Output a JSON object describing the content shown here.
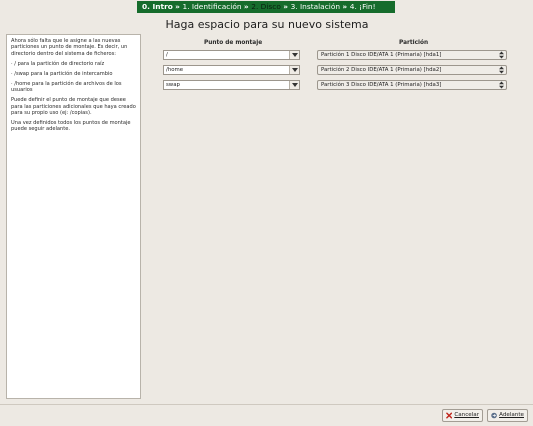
{
  "wizard": {
    "steps": [
      {
        "label": "0. Intro",
        "state": "done"
      },
      {
        "label": "1. Identificación",
        "state": "normal"
      },
      {
        "label": "2. Disco",
        "state": "current"
      },
      {
        "label": "3. Instalación",
        "state": "normal"
      },
      {
        "label": "4. ¡Fin!",
        "state": "normal"
      }
    ],
    "separator": "»",
    "bar_color": "#166c2c"
  },
  "page": {
    "title": "Haga espacio para su nuevo sistema"
  },
  "help": {
    "paragraphs": [
      "Ahora sólo falta que le asigne a las nuevas particiones un punto de montaje. Es decir, un directorio dentro del sistema de ficheros:",
      "· / para la partición de directorio raíz",
      "· /swap para la partición de intercambio",
      "· /home para la partición de archivos de los usuarios",
      "Puede definir el punto de montaje que desee para las particiones adicionales que haya creado para su propio uso (ej: /copias).",
      "Una vez definidos todos los puntos de montaje puede seguir adelante."
    ]
  },
  "table": {
    "headers": {
      "mount_point": "Punto de montaje",
      "partition": "Partición"
    },
    "rows": [
      {
        "mount_point": "/",
        "partition": "Partición 1 Disco IDE/ATA 1 (Primaria) [hda1]"
      },
      {
        "mount_point": "/home",
        "partition": "Partición 2 Disco IDE/ATA 1 (Primaria) [hda2]"
      },
      {
        "mount_point": "swap",
        "partition": "Partición 3 Disco IDE/ATA 1 (Primaria) [hda3]"
      }
    ]
  },
  "footer": {
    "cancel_label": "Cancelar",
    "next_label": "Adelante",
    "cancel_icon": "cancel-x-icon",
    "next_icon": "forward-arrow-icon"
  }
}
